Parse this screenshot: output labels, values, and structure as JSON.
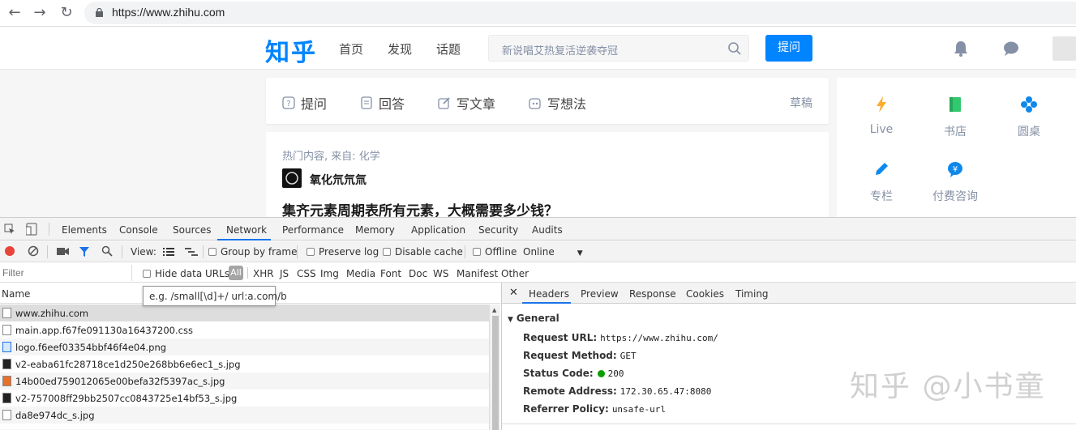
{
  "browser": {
    "url": "https://www.zhihu.com"
  },
  "header": {
    "logo": "知乎",
    "nav": [
      "首页",
      "发现",
      "话题"
    ],
    "search_placeholder": "新说唱艾热复活逆袭夺冠",
    "ask_button": "提问"
  },
  "write_bar": {
    "items": [
      {
        "label": "提问",
        "icon": "question-icon"
      },
      {
        "label": "回答",
        "icon": "answer-icon"
      },
      {
        "label": "写文章",
        "icon": "edit-icon"
      },
      {
        "label": "写想法",
        "icon": "idea-icon"
      }
    ],
    "drafts": "草稿"
  },
  "feed": {
    "source": "热门内容, 来自: 化学",
    "author": "氧化氘氘氚",
    "title": "集齐元素周期表所有元素，大概需要多少钱？"
  },
  "sidebar": {
    "items": [
      {
        "label": "Live",
        "icon": "lightning-icon",
        "color": "#ffab2e"
      },
      {
        "label": "书店",
        "icon": "book-icon",
        "color": "#32c86d"
      },
      {
        "label": "圆桌",
        "icon": "roundtable-icon",
        "color": "#0f88eb"
      },
      {
        "label": "专栏",
        "icon": "pen-icon",
        "color": "#0f88eb"
      },
      {
        "label": "付费咨询",
        "icon": "consult-icon",
        "color": "#0f88eb"
      }
    ]
  },
  "devtools": {
    "tabs": [
      "Elements",
      "Console",
      "Sources",
      "Network",
      "Performance",
      "Memory",
      "Application",
      "Security",
      "Audits"
    ],
    "active_tab": "Network",
    "toolbar": {
      "view_label": "View:",
      "group_by_frame": "Group by frame",
      "preserve_log": "Preserve log",
      "disable_cache": "Disable cache",
      "offline": "Offline",
      "throttle": "Online"
    },
    "filter": {
      "placeholder": "Filter",
      "hide_data_urls": "Hide data URLs",
      "all": "All",
      "types": [
        "XHR",
        "JS",
        "CSS",
        "Img",
        "Media",
        "Font",
        "Doc",
        "WS",
        "Manifest",
        "Other"
      ]
    },
    "tooltip": "e.g. /small[\\d]+/ url:a.com/b",
    "name_header": "Name",
    "requests": [
      {
        "name": "www.zhihu.com",
        "type": "doc"
      },
      {
        "name": "main.app.f67fe091130a16437200.css",
        "type": "css"
      },
      {
        "name": "logo.f6eef03354bbf46f4e04.png",
        "type": "img"
      },
      {
        "name": "v2-eaba61fc28718ce1d250e268bb6e6ec1_s.jpg",
        "type": "img"
      },
      {
        "name": "14b00ed759012065e00befa32f5397ac_s.jpg",
        "type": "img"
      },
      {
        "name": "v2-757008ff29bb2507cc0843725e14bf53_s.jpg",
        "type": "img"
      },
      {
        "name": "da8e974dc_s.jpg",
        "type": "img"
      }
    ],
    "detail_tabs": [
      "Headers",
      "Preview",
      "Response",
      "Cookies",
      "Timing"
    ],
    "general": {
      "title": "General",
      "request_url_label": "Request URL:",
      "request_url": "https://www.zhihu.com/",
      "request_method_label": "Request Method:",
      "request_method": "GET",
      "status_code_label": "Status Code:",
      "status_code": "200",
      "remote_address_label": "Remote Address:",
      "remote_address": "172.30.65.47:8080",
      "referrer_policy_label": "Referrer Policy:",
      "referrer_policy": "unsafe-url"
    }
  },
  "watermark": "知乎 @小书童"
}
